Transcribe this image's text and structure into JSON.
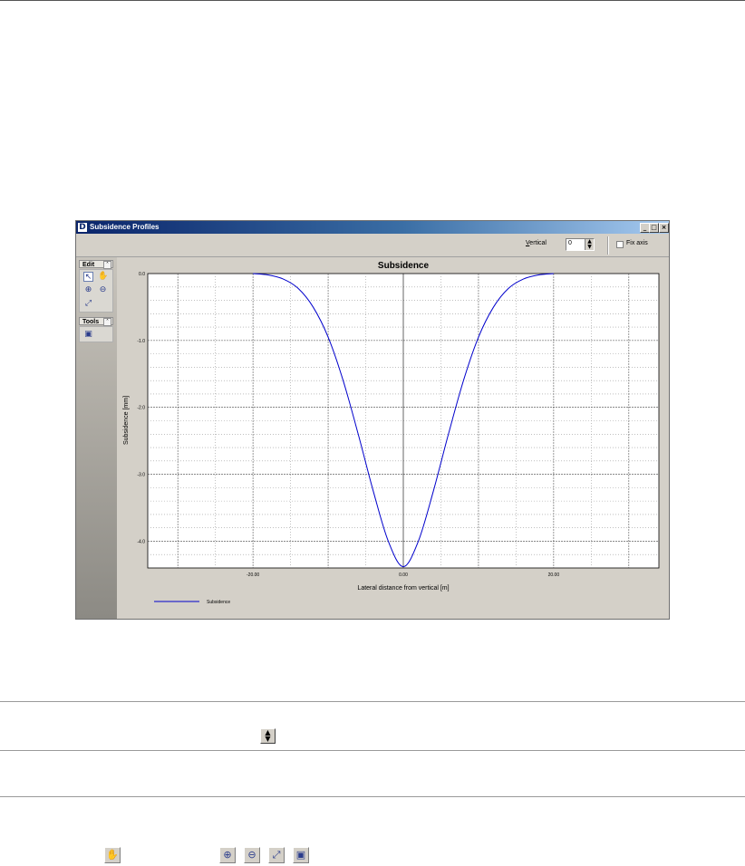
{
  "window": {
    "title": "Subsidence Profiles",
    "app_icon": "D",
    "controls": [
      "minimize-icon",
      "maximize-icon",
      "close-icon"
    ]
  },
  "toolbar": {
    "vertical_label_accel": "V",
    "vertical_label_rest": "ertical",
    "vertical_value": "0",
    "fix_axis_label": "Fix axis",
    "fix_axis_checked": false
  },
  "side_panel": {
    "edit_group": "Edit",
    "tools_group": "Tools",
    "edit_icons": [
      "select-arrow-icon",
      "pan-hand-icon",
      "zoom-in-icon",
      "zoom-out-icon",
      "zoom-extent-icon"
    ],
    "tools_icons": [
      "copy-chart-icon"
    ]
  },
  "chart_data": {
    "type": "line",
    "title": "Subsidence",
    "xlabel": "Lateral distance from vertical [m]",
    "ylabel": "Subsidence [mm]",
    "xlim": [
      -34,
      34
    ],
    "ylim": [
      -4.4,
      0.0
    ],
    "x_ticks": [
      -20.0,
      0.0,
      20.0
    ],
    "x_tick_labels": [
      "-20.00",
      "0.00",
      "20.00"
    ],
    "y_ticks": [
      0.0,
      -1.0,
      -2.0,
      -3.0,
      -4.0
    ],
    "y_tick_labels": [
      "0.0",
      "-1.0",
      "-2.0",
      "-3.0",
      "-4.0"
    ],
    "grid": true,
    "legend": "bottom-left",
    "series": [
      {
        "name": "Subsidence",
        "color": "#0000cc",
        "x": [
          -20,
          -18,
          -16,
          -14,
          -12,
          -10,
          -8,
          -6,
          -4,
          -2,
          0,
          2,
          4,
          6,
          8,
          10,
          12,
          14,
          16,
          18,
          20
        ],
        "y": [
          0.0,
          -0.02,
          -0.08,
          -0.22,
          -0.5,
          -0.95,
          -1.6,
          -2.4,
          -3.25,
          -4.0,
          -4.38,
          -4.0,
          -3.25,
          -2.4,
          -1.6,
          -0.95,
          -0.5,
          -0.22,
          -0.08,
          -0.02,
          0.0
        ]
      }
    ]
  },
  "bottom_icons": {
    "spinner": "spinner-icon",
    "buttons": [
      "pan-hand-icon",
      "zoom-in-icon",
      "zoom-out-icon",
      "zoom-extent-icon",
      "copy-chart-icon"
    ]
  },
  "colors": {
    "window_bg": "#d4d0c8",
    "titlebar": "#0a246a",
    "series": "#0000cc"
  }
}
